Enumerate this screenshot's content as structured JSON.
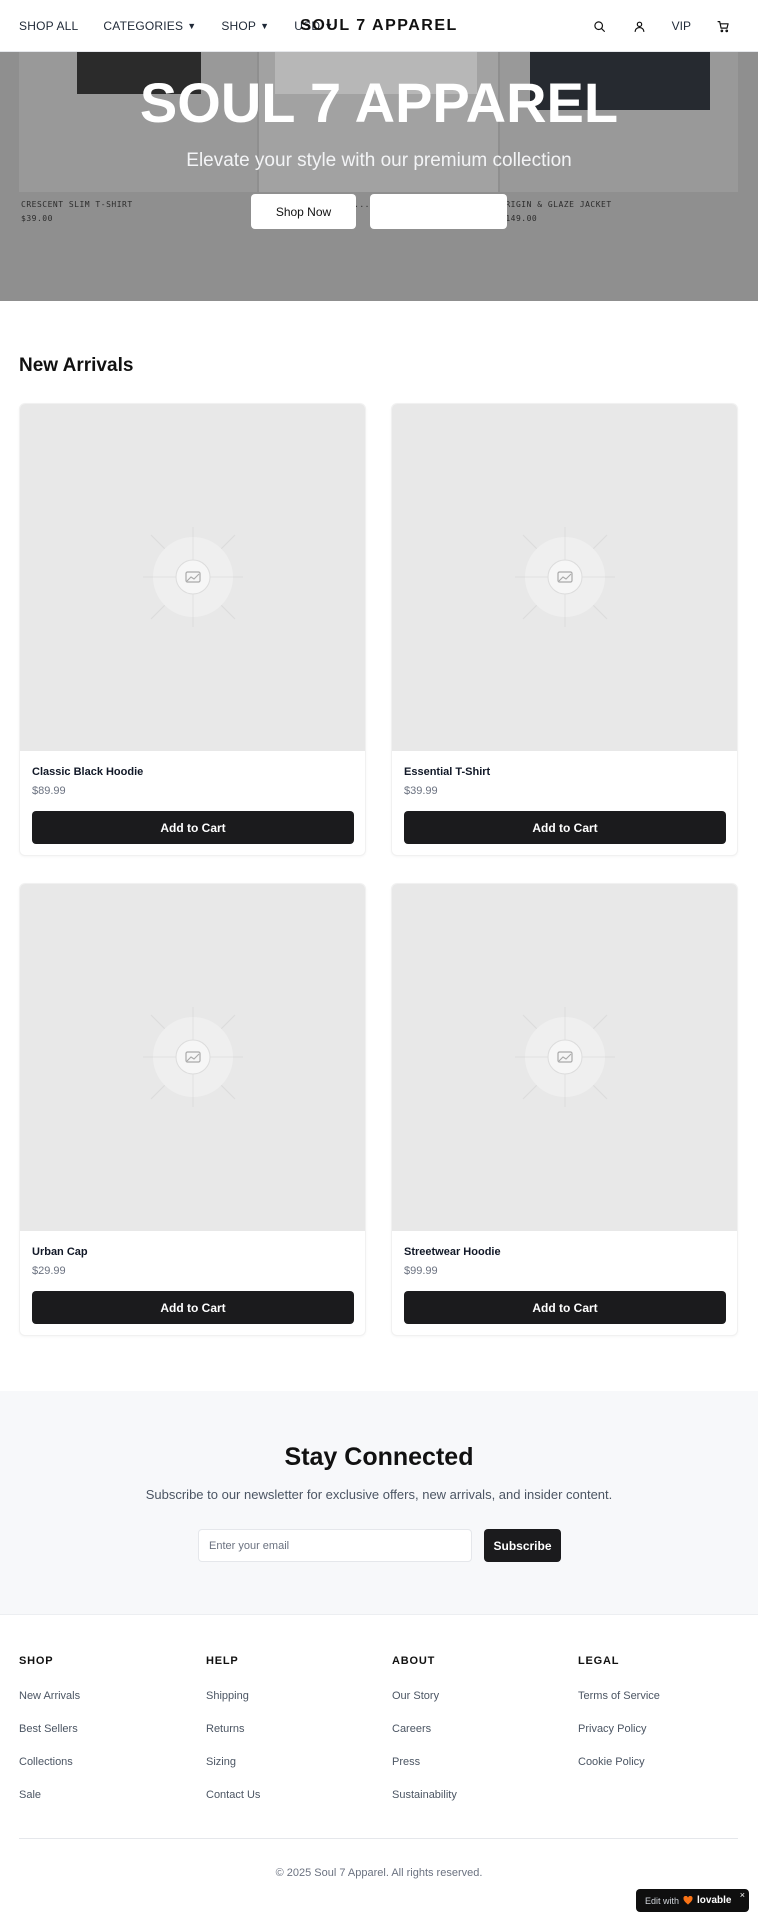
{
  "header": {
    "nav": [
      {
        "label": "SHOP ALL",
        "caret": false
      },
      {
        "label": "CATEGORIES",
        "caret": true
      },
      {
        "label": "SHOP",
        "caret": true
      },
      {
        "label": "USD",
        "caret": true
      }
    ],
    "caret_glyph": "▼",
    "brand": "SOUL 7 APPAREL",
    "vip": "VIP",
    "icons": [
      "search-icon",
      "user-icon",
      "cart-icon"
    ]
  },
  "hero": {
    "title": "SOUL 7 APPAREL",
    "subtitle": "Elevate your style with our premium collection",
    "primary_button": "Shop Now",
    "secondary_button": "",
    "background_captions": [
      {
        "name": "CRESCENT SLIM T-SHIRT",
        "price": "$39.00"
      },
      {
        "name": "...",
        "price": ""
      },
      {
        "name": "ORIGIN & GLAZE JACKET",
        "price": "$149.00"
      }
    ]
  },
  "arrivals": {
    "title": "New Arrivals",
    "products": [
      {
        "name": "Classic Black Hoodie",
        "price": "$89.99",
        "button": "Add to Cart"
      },
      {
        "name": "Essential T-Shirt",
        "price": "$39.99",
        "button": "Add to Cart"
      },
      {
        "name": "Urban Cap",
        "price": "$29.99",
        "button": "Add to Cart"
      },
      {
        "name": "Streetwear Hoodie",
        "price": "$99.99",
        "button": "Add to Cart"
      }
    ]
  },
  "newsletter": {
    "title": "Stay Connected",
    "text": "Subscribe to our newsletter for exclusive offers, new arrivals, and insider content.",
    "placeholder": "Enter your email",
    "button": "Subscribe"
  },
  "footer": {
    "columns": [
      {
        "heading": "SHOP",
        "links": [
          "New Arrivals",
          "Best Sellers",
          "Collections",
          "Sale"
        ]
      },
      {
        "heading": "HELP",
        "links": [
          "Shipping",
          "Returns",
          "Sizing",
          "Contact Us"
        ]
      },
      {
        "heading": "ABOUT",
        "links": [
          "Our Story",
          "Careers",
          "Press",
          "Sustainability"
        ]
      },
      {
        "heading": "LEGAL",
        "links": [
          "Terms of Service",
          "Privacy Policy",
          "Cookie Policy"
        ]
      }
    ],
    "copyright": "© 2025 Soul 7 Apparel. All rights reserved."
  },
  "badge": {
    "edit_with": "Edit with",
    "brand": "lovable",
    "close": "×",
    "icon": "heart-icon"
  },
  "colors": {
    "hero_bg": "#8f8f8f",
    "button_dark": "#1b1b1d",
    "placeholder_bg": "#e8e8e8",
    "newsletter_bg": "#f7f8fa"
  }
}
